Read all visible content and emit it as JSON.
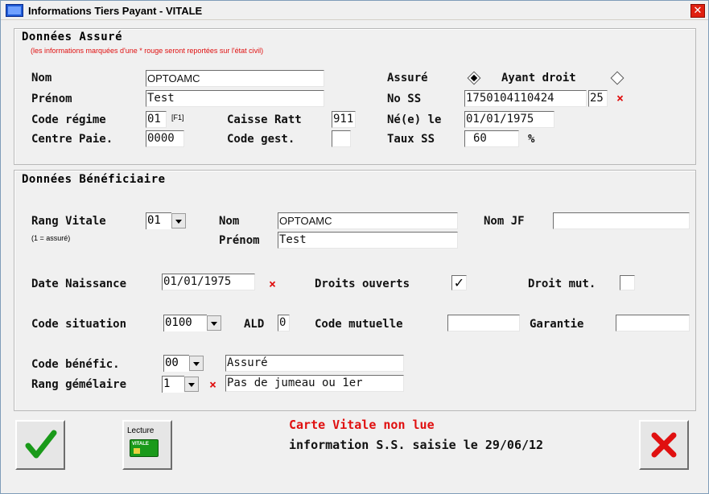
{
  "window": {
    "title": "Informations Tiers Payant - VITALE",
    "close_glyph": "✕"
  },
  "assure": {
    "title": "Données Assuré",
    "note": "(les informations marquées d'une * rouge seront reportées sur l'état civil)",
    "nom_label": "Nom",
    "nom_value": "OPTOAMC",
    "prenom_label": "Prénom",
    "prenom_value": "Test",
    "code_regime_label": "Code régime",
    "code_regime_value": "01",
    "code_regime_hint": "[F1]",
    "caisse_label": "Caisse Ratt",
    "caisse_value": "911",
    "centre_label": "Centre Paie.",
    "centre_value": "0000",
    "code_gest_label": "Code gest.",
    "code_gest_value": "",
    "assure_radio_label": "Assuré",
    "ayant_droit_label": "Ayant droit",
    "no_ss_label": "No SS",
    "no_ss_value": "1750104110424",
    "no_ss_key": "25",
    "ne_label": "Né(e) le",
    "ne_value": "01/01/1975",
    "taux_label": "Taux SS",
    "taux_value": "60",
    "taux_unit": "%",
    "selected_radio": "Assuré"
  },
  "beneficiaire": {
    "title": "Données Bénéficiaire",
    "rang_label": "Rang Vitale",
    "rang_value": "01",
    "rang_note": "(1 = assuré)",
    "nom_label": "Nom",
    "nom_value": "OPTOAMC",
    "prenom_label": "Prénom",
    "prenom_value": "Test",
    "nom_jf_label": "Nom JF",
    "nom_jf_value": "",
    "date_label": "Date Naissance",
    "date_value": "01/01/1975",
    "droits_label": "Droits ouverts",
    "droits_checked": "✓",
    "droit_mut_label": "Droit mut.",
    "droit_mut_checked": "",
    "code_situation_label": "Code situation",
    "code_situation_value": "0100",
    "ald_label": "ALD",
    "ald_value": "0",
    "code_mutuelle_label": "Code mutuelle",
    "code_mutuelle_value": "",
    "garantie_label": "Garantie",
    "garantie_value": "",
    "code_benef_label": "Code bénéfic.",
    "code_benef_value": "00",
    "code_benef_desc": "Assuré",
    "rang_gem_label": "Rang gémélaire",
    "rang_gem_value": "1",
    "rang_gem_desc": "Pas de jumeau ou 1er"
  },
  "footer": {
    "lecture_label": "Lecture",
    "card_label": "VITALE",
    "status_red": "Carte Vitale non lue",
    "status_info": "information S.S. saisie le 29/06/12"
  },
  "colors": {
    "required_star": "#e01010",
    "status_red": "#e01010",
    "note_red": "#e01010",
    "confirm_green": "#1a9a1a",
    "cancel_red": "#e01010"
  },
  "required_star_glyph": "×"
}
